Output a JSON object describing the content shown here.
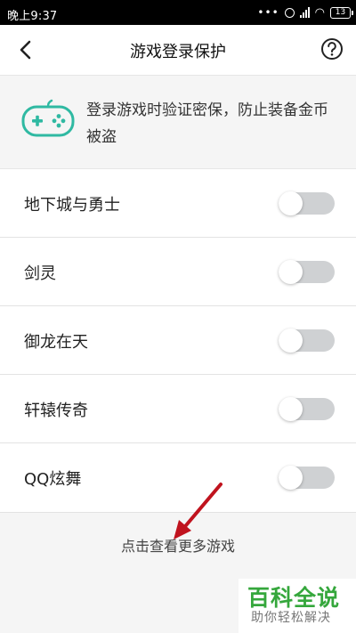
{
  "status_bar": {
    "time": "晚上9:37",
    "battery": "13",
    "icons": [
      "dots-icon",
      "alarm-icon",
      "signal-icon",
      "wifi-icon",
      "battery-icon"
    ]
  },
  "header": {
    "title": "游戏登录保护",
    "icons": [
      "back-arrow-icon",
      "help-icon"
    ]
  },
  "info": {
    "text": "登录游戏时验证密保，防止装备金币被盗",
    "icon": "gamepad-icon",
    "accent": "#2fb9a2"
  },
  "games": [
    {
      "name": "地下城与勇士",
      "enabled": false
    },
    {
      "name": "剑灵",
      "enabled": false
    },
    {
      "name": "御龙在天",
      "enabled": false
    },
    {
      "name": "轩辕传奇",
      "enabled": false
    },
    {
      "name": "QQ炫舞",
      "enabled": false
    }
  ],
  "more_link": "点击查看更多游戏",
  "watermark": {
    "main": "百科全说",
    "sub": "助你轻松解决",
    "color": "#35a73c"
  },
  "colors": {
    "toggle_off": "#cfd1d3",
    "annotation_arrow": "#c0131e"
  }
}
